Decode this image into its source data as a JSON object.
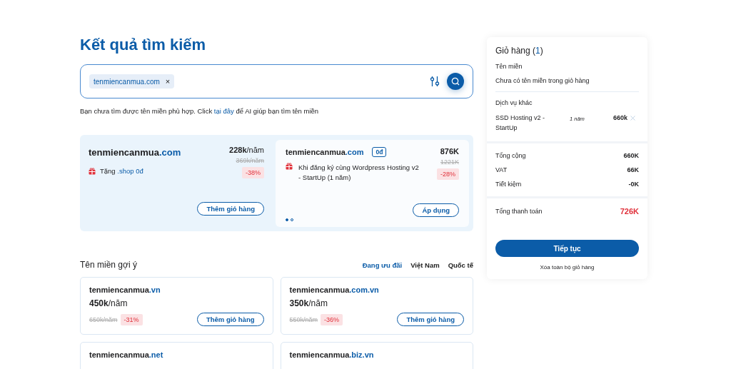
{
  "title": "Kết quả tìm kiếm",
  "search": {
    "chips": [
      {
        "label": "tenmiencanmua.com",
        "remove": "×"
      }
    ]
  },
  "hint": {
    "before": "Bạn chưa tìm được tên miền phù hợp. Click ",
    "link": "tại đây",
    "after": " để AI giúp bạn tìm tên miền"
  },
  "featured": {
    "name": "tenmiencanmua",
    "tld": ".com",
    "promo_prefix": "Tặng",
    "promo_highlight": ".shop 0đ",
    "price": "228k",
    "unit": "/năm",
    "old_price": "369k/năm",
    "discount": "-38%",
    "button": "Thêm giỏ hàng"
  },
  "offer": {
    "name": "tenmiencanmua",
    "tld": ".com",
    "badge": "0đ",
    "price": "876K",
    "old_price": "1221K",
    "discount": "-28%",
    "description": "Khi đăng ký cùng Wordpress Hosting v2 - StartUp (1 năm)",
    "button": "Áp dụng",
    "dots": [
      {
        "selected": true
      },
      {
        "selected": false
      }
    ]
  },
  "suggest": {
    "title": "Tên miền gợi ý",
    "filters": [
      {
        "label": "Đang ưu đãi",
        "selected": true
      },
      {
        "label": "Việt Nam",
        "selected": false
      },
      {
        "label": "Quốc tế",
        "selected": false
      }
    ],
    "items": [
      {
        "name": "tenmiencanmua",
        "tld": ".vn",
        "price": "450k",
        "unit": "/năm",
        "old_price": "650k/năm",
        "discount": "-31%",
        "button": "Thêm giỏ hàng"
      },
      {
        "name": "tenmiencanmua",
        "tld": ".com.vn",
        "price": "350k",
        "unit": "/năm",
        "old_price": "550k/năm",
        "discount": "-36%",
        "button": "Thêm giỏ hàng"
      },
      {
        "name": "tenmiencanmua",
        "tld": ".net"
      },
      {
        "name": "tenmiencanmua",
        "tld": ".biz.vn"
      }
    ]
  },
  "cart": {
    "title": "Giỏ hàng (",
    "count": "1",
    "title_end": ")",
    "domains_label": "Tên miền",
    "domains_empty": "Chưa có tên miền trong giỏ hàng",
    "services_label": "Dịch vụ khác",
    "services": [
      {
        "name": "SSD Hosting v2 - StartUp",
        "term": "1 năm",
        "price": "660k"
      }
    ],
    "totals": [
      {
        "label": "Tổng cộng",
        "value": "660K"
      },
      {
        "label": "VAT",
        "value": "66K"
      },
      {
        "label": "Tiết kiệm",
        "value": "-0K"
      }
    ],
    "pay_label": "Tổng thanh toán",
    "pay_value": "726K",
    "button": "Tiếp tục",
    "clear": "Xóa toàn bộ giỏ hàng"
  }
}
